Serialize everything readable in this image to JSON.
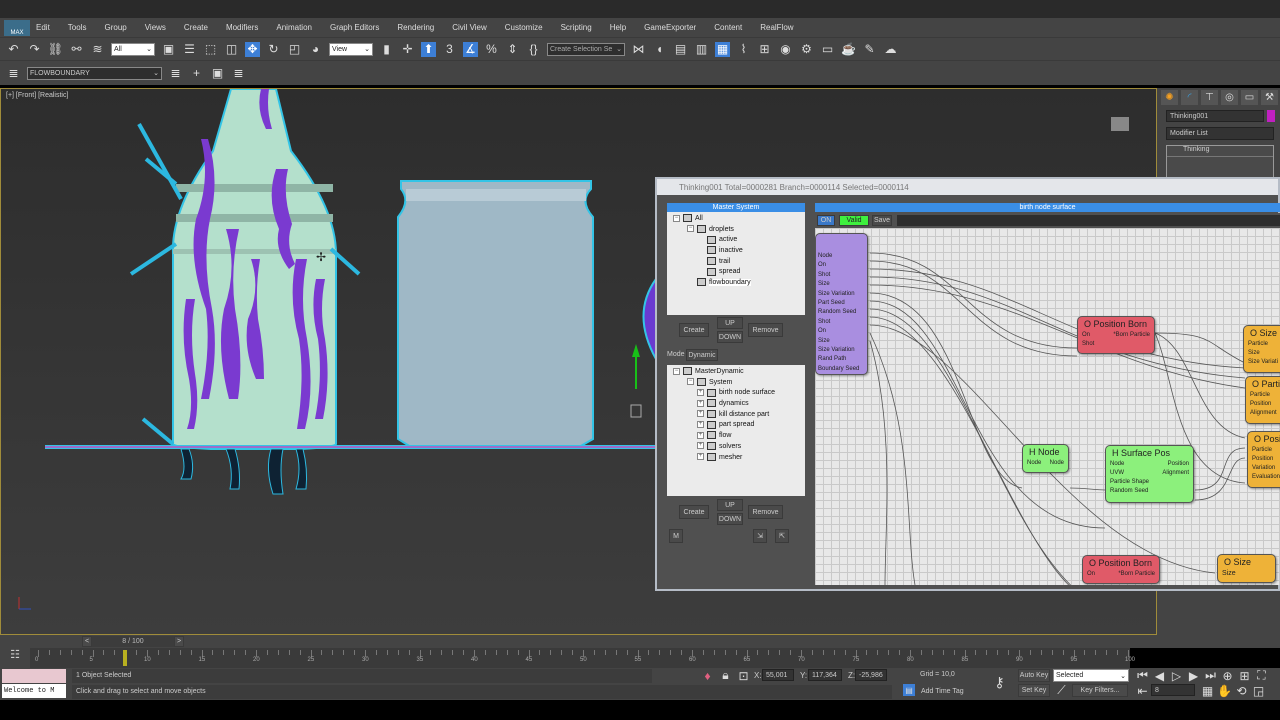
{
  "menu": {
    "logo": "MAX",
    "items": [
      "Edit",
      "Tools",
      "Group",
      "Views",
      "Create",
      "Modifiers",
      "Animation",
      "Graph Editors",
      "Rendering",
      "Civil View",
      "Customize",
      "Scripting",
      "Help",
      "GameExporter",
      "Content",
      "RealFlow"
    ]
  },
  "toolbar": {
    "selection_filter": "All",
    "ref_coord": "View",
    "named_selection": "Create Selection Se",
    "snap_angle": "3",
    "layer": "FLOWBOUNDARY"
  },
  "viewport": {
    "label": "[+] [Front] [Realistic]"
  },
  "command_panel": {
    "object_name": "Thinking001",
    "object_color": "#c020c0",
    "modifier_list": "Modifier List",
    "stack_item": "Thinking"
  },
  "thinking": {
    "title": "Thinking001  Total=0000281  Branch=0000114  Selected=0000114",
    "master_system": {
      "header": "Master System",
      "items": [
        "All",
        "droplets",
        "active",
        "inactive",
        "trail",
        "spread",
        "flowboundary"
      ]
    },
    "buttons": {
      "create": "Create",
      "up": "UP",
      "down": "DOWN",
      "remove": "Remove",
      "m": "M"
    },
    "mode_label": "Mode",
    "mode_value": "Dynamic",
    "dynamic_tree": {
      "root": "MasterDynamic",
      "system": "System",
      "items": [
        "birth node surface",
        "dynamics",
        "kill distance part",
        "part spread",
        "flow",
        "solvers",
        "mesher"
      ]
    },
    "graph": {
      "header": "birth node surface",
      "on": "ON",
      "valid": "Valid",
      "save": "Save",
      "input_node": {
        "ports": [
          "Node",
          "On",
          "Shot",
          "Size",
          "Size Variation",
          "Part Seed",
          "Random Seed",
          "Shot",
          "On",
          "Size",
          "Size Variation",
          "Rand Path",
          "Boundary Seed"
        ]
      },
      "nodes": [
        {
          "title": "O Position Born",
          "left": [
            "On",
            "Shot"
          ],
          "right": [
            "*Born Particle"
          ]
        },
        {
          "title": "O Size",
          "left": [
            "Particle",
            "Size",
            "Size Variati"
          ],
          "right": []
        },
        {
          "title": "O Parti",
          "left": [
            "Particle",
            "Position",
            "Alignment"
          ],
          "right": []
        },
        {
          "title": "O Posi",
          "left": [
            "Particle",
            "Position",
            "Variation",
            "Evaluation"
          ],
          "right": []
        },
        {
          "title": "H Node",
          "left": [
            "Node"
          ],
          "right": [
            "Node"
          ]
        },
        {
          "title": "H Surface Pos",
          "left": [
            "Node",
            "UVW",
            "Particle Shape",
            "Random Seed"
          ],
          "right": [
            "Position",
            "Alignment"
          ]
        },
        {
          "title": "O Position Born",
          "left": [
            "On"
          ],
          "right": [
            "*Born Particle"
          ]
        },
        {
          "title": "O Size",
          "left": [
            "Size"
          ],
          "right": []
        }
      ]
    }
  },
  "timeline": {
    "frame_display": "8 / 100",
    "current_frame": 8,
    "total_frames": 100,
    "tick_labels": [
      "0",
      "5",
      "10",
      "15",
      "20",
      "25",
      "30",
      "35",
      "40",
      "45",
      "50",
      "55",
      "60",
      "65",
      "70",
      "75",
      "80",
      "85",
      "90",
      "95",
      "100"
    ],
    "prev": "<",
    "next": ">"
  },
  "status": {
    "selected": "1 Object Selected",
    "prompt": "Click and drag to select and move objects",
    "maxscript": "Welcome to M",
    "x_label": "X:",
    "x": "55,001",
    "y_label": "Y:",
    "y": "117,364",
    "z_label": "Z:",
    "z": "-25,986",
    "grid": "Grid = 10,0",
    "add_time_tag": "Add Time Tag",
    "auto_key": "Auto Key",
    "set_key": "Set Key",
    "key_mode": "Selected",
    "key_filters": "Key Filters...",
    "frame_field": "8"
  }
}
